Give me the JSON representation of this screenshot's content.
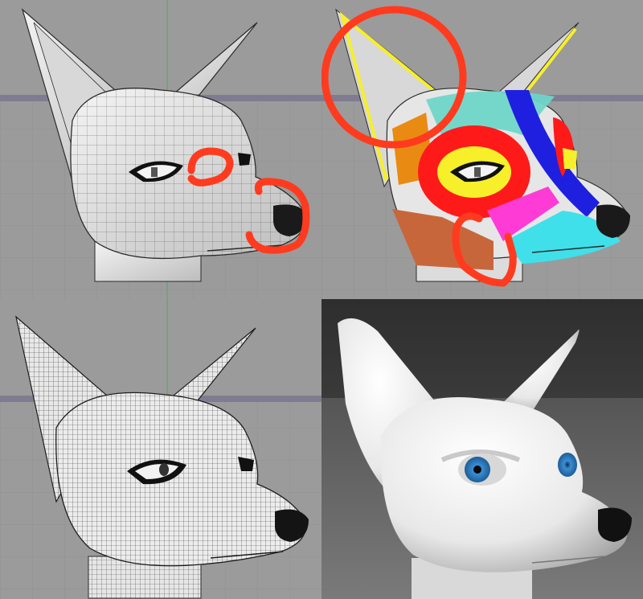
{
  "figure": {
    "panels": [
      {
        "id": "wireframe-low-poly-annotated",
        "view": "viewport-wireframe",
        "annotation_color": "#ff3b1f"
      },
      {
        "id": "topology-colored-regions",
        "view": "viewport-edge-loops",
        "annotation_color": "#ff3b1f"
      },
      {
        "id": "wireframe-high-poly",
        "view": "viewport-subdivided"
      },
      {
        "id": "render-shaded",
        "view": "render",
        "eye_color": "#3a8fd6"
      }
    ],
    "colors": {
      "viewport_bg": "#9a9a9a",
      "viewport_floor": "#b3b3b6",
      "horizon_band": "#7f7c92",
      "mesh_light": "#e9e9e9",
      "mesh_line": "#2b2b2b",
      "render_bg": "#3a3a3a",
      "render_floor": "#6a6a6a",
      "annotation": "#ff3b1f",
      "region_red": "#ff1a1a",
      "region_blue": "#1f1fe0",
      "region_yellow": "#f6ef2a",
      "region_cyan": "#3fe0ea",
      "region_orange": "#e98a12",
      "region_brown": "#c8663b",
      "region_magenta": "#ff3bd6",
      "region_teal": "#6fd6c8"
    }
  }
}
